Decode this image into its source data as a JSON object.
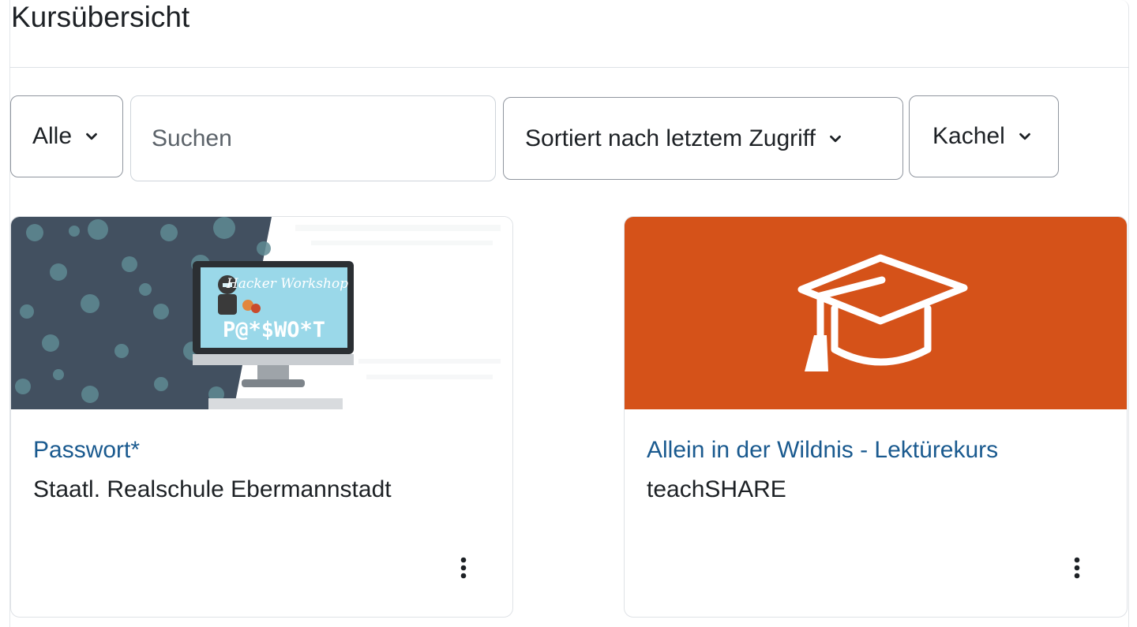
{
  "header": {
    "title": "Kursübersicht"
  },
  "filters": {
    "grouping_label": "Alle",
    "search_placeholder": "Suchen",
    "sort_label": "Sortiert nach letztem Zugriff",
    "view_label": "Kachel"
  },
  "courses": [
    {
      "name": "Passwort*",
      "category": "Staatl. Realschule Ebermannstadt",
      "image_text": "Hacker Workshop",
      "image_title": "P@*$WO*T"
    },
    {
      "name": "Allein in der Wildnis - Lektürekurs",
      "category": "teachSHARE",
      "image_color": "#d55219",
      "icon": "graduation-cap-icon"
    }
  ],
  "colors": {
    "link": "#1a5a8f",
    "course_accent": "#d55219"
  },
  "icons": {
    "chevron": "chevron-down-icon",
    "menu": "kebab-menu-icon"
  }
}
